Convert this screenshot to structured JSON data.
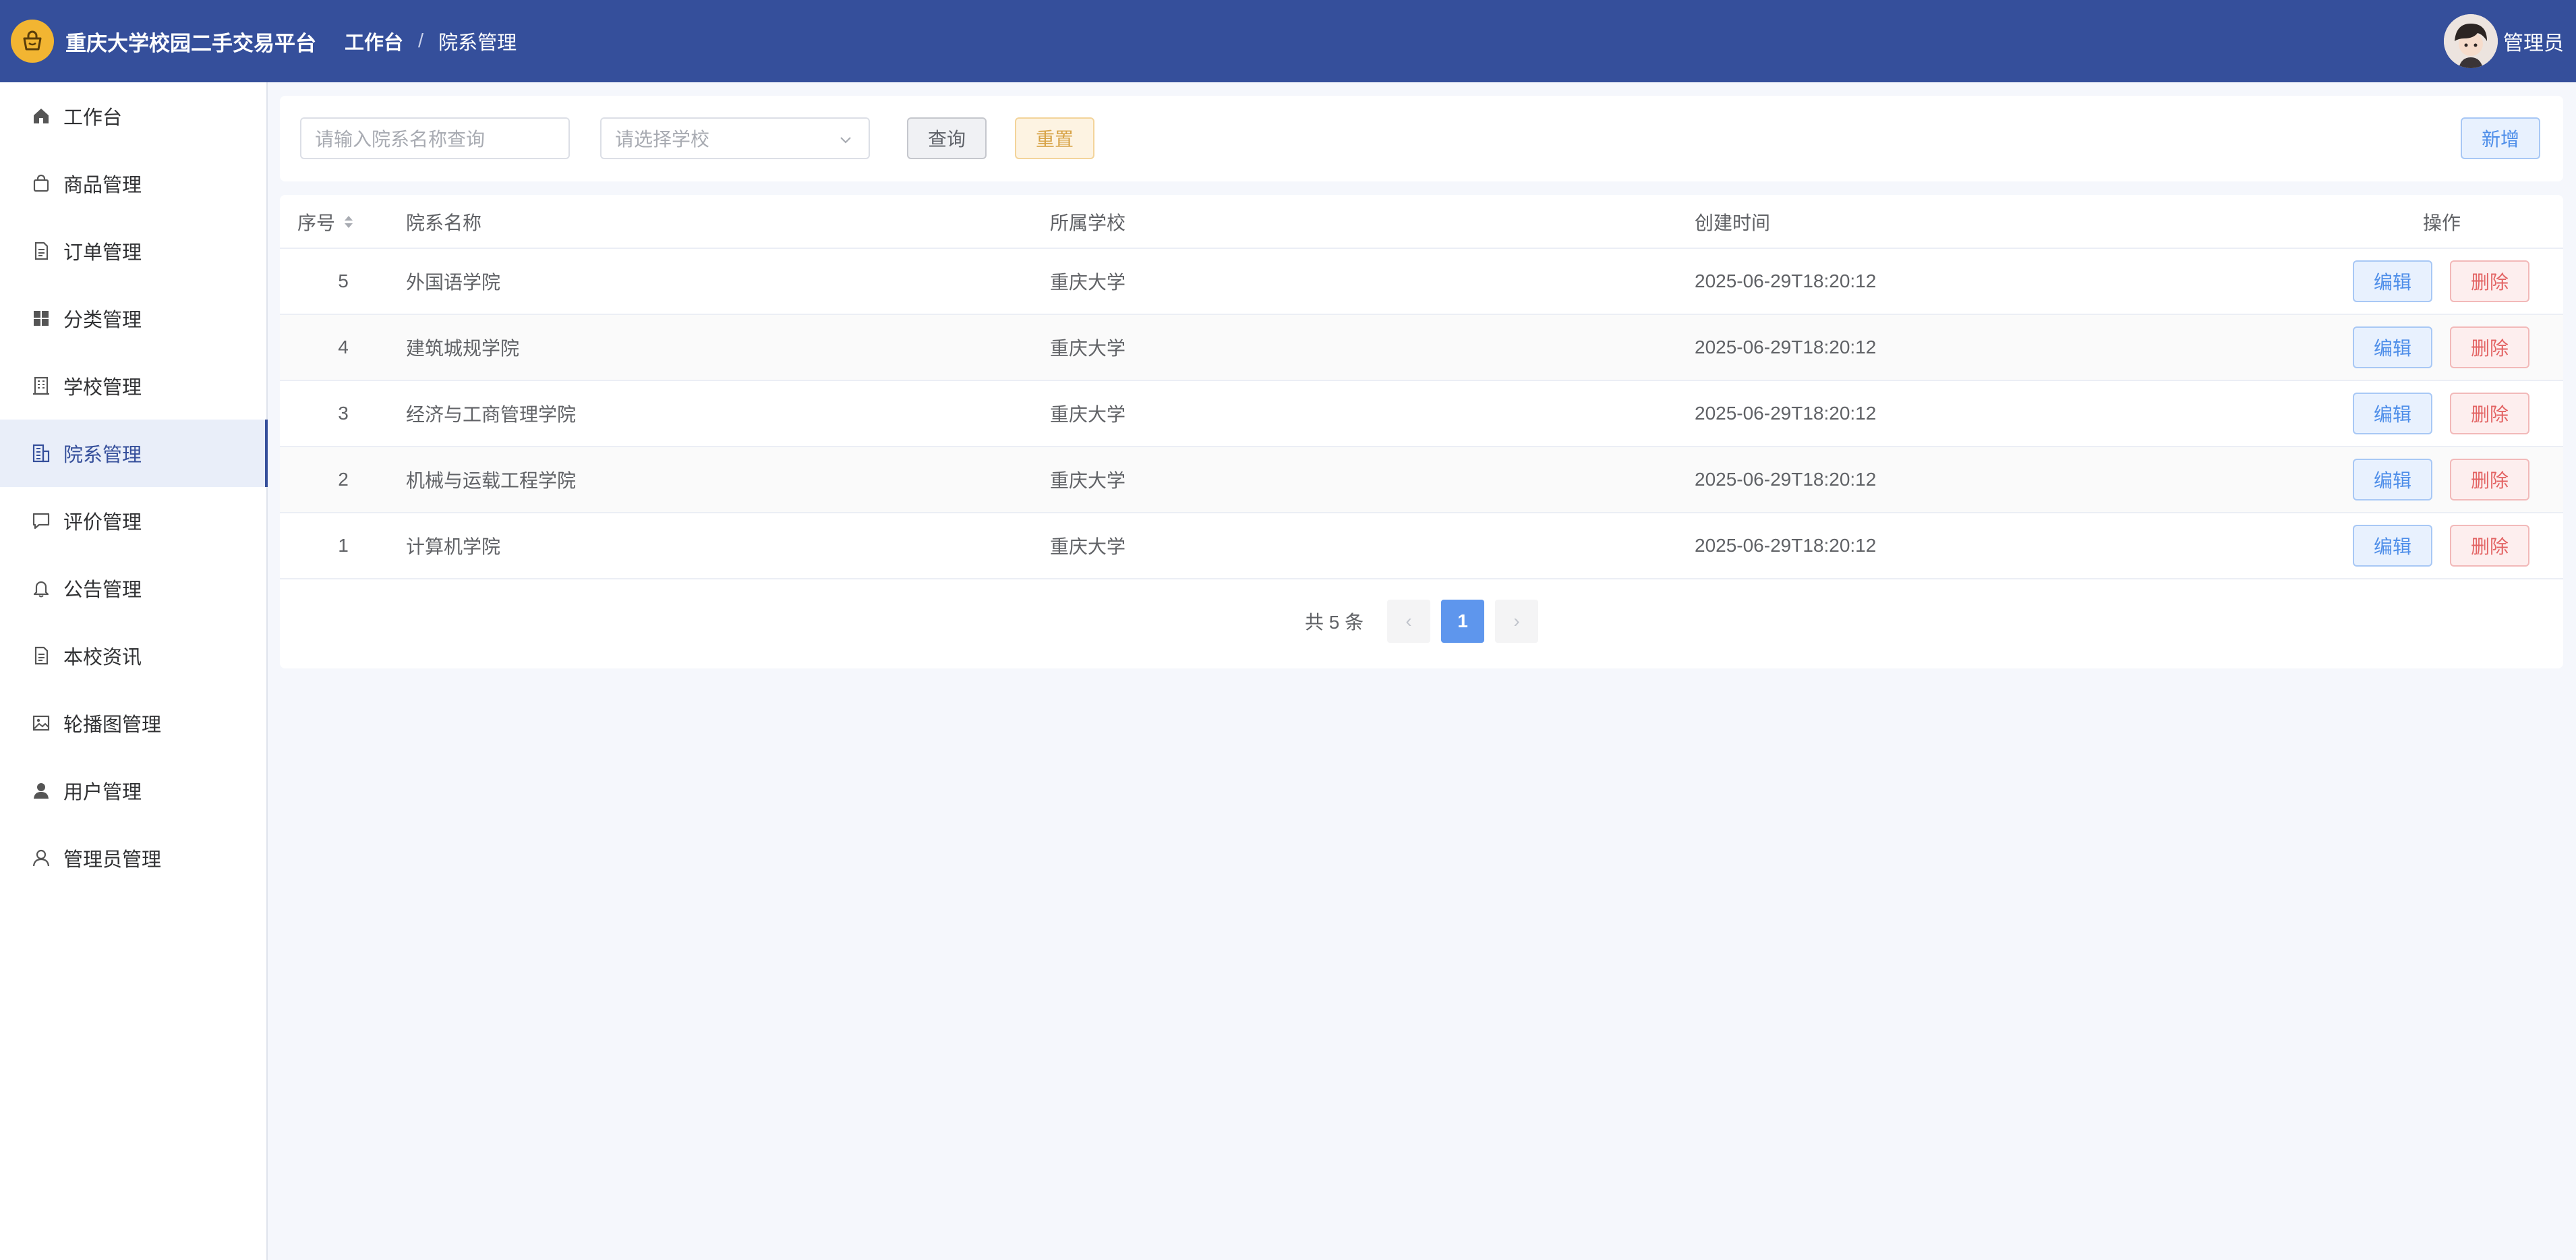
{
  "colors": {
    "header": "#354f9b",
    "logo": "#f2b532",
    "primary": "#5e96ed",
    "warning": "#d7a347",
    "danger": "#e36464",
    "background": "#f5f7fc"
  },
  "header": {
    "app_title": "重庆大学校园二手交易平台",
    "breadcrumb": [
      "工作台",
      "院系管理"
    ],
    "user_name": "管理员"
  },
  "sidebar": {
    "items": [
      {
        "label": "工作台",
        "icon": "home-icon"
      },
      {
        "label": "商品管理",
        "icon": "shopping-bag-icon"
      },
      {
        "label": "订单管理",
        "icon": "document-icon"
      },
      {
        "label": "分类管理",
        "icon": "grid-icon"
      },
      {
        "label": "学校管理",
        "icon": "building-icon"
      },
      {
        "label": "院系管理",
        "icon": "office-building-icon",
        "active": true
      },
      {
        "label": "评价管理",
        "icon": "chat-bubble-icon"
      },
      {
        "label": "公告管理",
        "icon": "bell-icon"
      },
      {
        "label": "本校资讯",
        "icon": "document-icon"
      },
      {
        "label": "轮播图管理",
        "icon": "image-icon"
      },
      {
        "label": "用户管理",
        "icon": "user-filled-icon"
      },
      {
        "label": "管理员管理",
        "icon": "user-outline-icon"
      }
    ]
  },
  "search": {
    "name_placeholder": "请输入院系名称查询",
    "school_placeholder": "请选择学校",
    "query_label": "查询",
    "reset_label": "重置",
    "add_label": "新增"
  },
  "table": {
    "columns": [
      "序号",
      "院系名称",
      "所属学校",
      "创建时间",
      "操作"
    ],
    "edit_label": "编辑",
    "delete_label": "删除",
    "rows": [
      {
        "id": "5",
        "name": "外国语学院",
        "school": "重庆大学",
        "created": "2025-06-29T18:20:12"
      },
      {
        "id": "4",
        "name": "建筑城规学院",
        "school": "重庆大学",
        "created": "2025-06-29T18:20:12"
      },
      {
        "id": "3",
        "name": "经济与工商管理学院",
        "school": "重庆大学",
        "created": "2025-06-29T18:20:12"
      },
      {
        "id": "2",
        "name": "机械与运载工程学院",
        "school": "重庆大学",
        "created": "2025-06-29T18:20:12"
      },
      {
        "id": "1",
        "name": "计算机学院",
        "school": "重庆大学",
        "created": "2025-06-29T18:20:12"
      }
    ]
  },
  "pagination": {
    "total_text": "共 5 条",
    "current_page": "1",
    "prev": "‹",
    "next": "›"
  }
}
